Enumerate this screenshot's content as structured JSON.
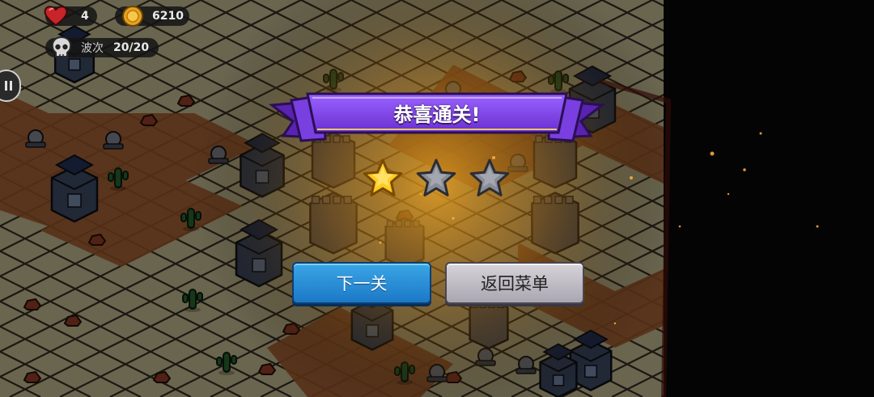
{
  "hud": {
    "lives": "4",
    "gold": "6210",
    "wave_label": "波次",
    "wave_value": "20/20",
    "icons": [
      "heart-icon",
      "coin-icon",
      "skull-icon",
      "pause-icon"
    ]
  },
  "victory_dialog": {
    "title": "恭喜通关!",
    "stars_earned": 1,
    "stars_total": 3,
    "next_level_label": "下一关",
    "menu_label": "返回菜单"
  },
  "colors": {
    "banner": "#7a3fe0",
    "star_gold": "#ffcc22",
    "star_gray": "#8a8d96",
    "button_blue": "#2a8fd8",
    "button_gray": "#c4c1c9"
  }
}
